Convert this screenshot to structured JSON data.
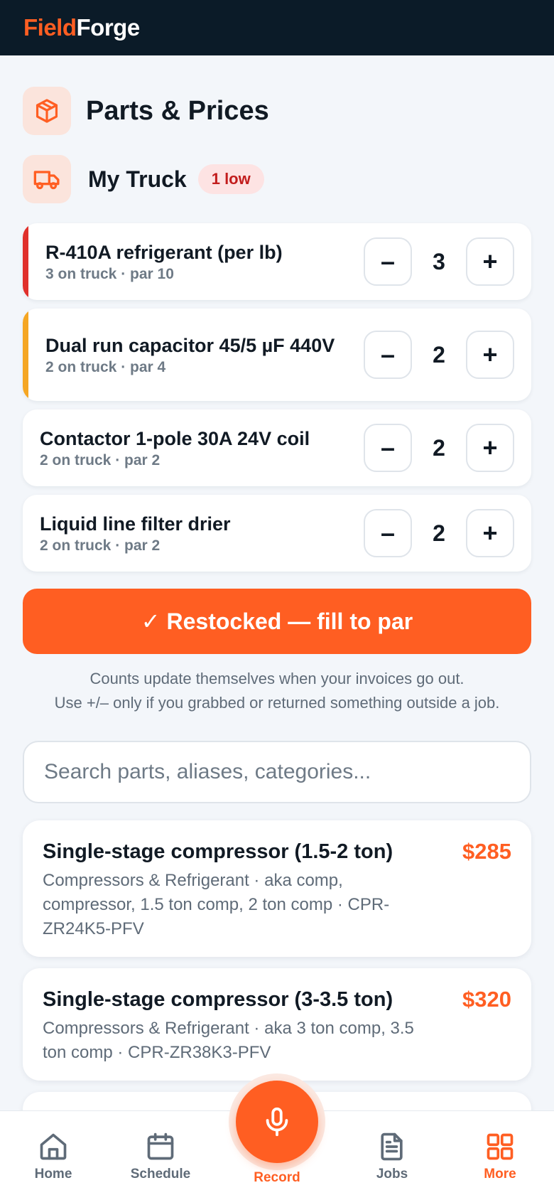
{
  "brand": {
    "part1": "Field",
    "part2": "Forge"
  },
  "page": {
    "title": "Parts & Prices"
  },
  "truck": {
    "title": "My Truck",
    "badge": "1 low",
    "items": [
      {
        "name": "R-410A refrigerant (per lb)",
        "sub": "3 on truck · par 10",
        "qty": "3",
        "flag_color": "#e0302b"
      },
      {
        "name": "Dual run capacitor 45/5 µF 440V",
        "sub": "2 on truck · par 4",
        "qty": "2",
        "flag_color": "#f5a623"
      },
      {
        "name": "Contactor 1-pole 30A 24V coil",
        "sub": "2 on truck · par 2",
        "qty": "2"
      },
      {
        "name": "Liquid line filter drier",
        "sub": "2 on truck · par 2",
        "qty": "2"
      }
    ],
    "minus": "–",
    "plus": "+",
    "restock_label": "✓ Restocked — fill to par",
    "hint_line1": "Counts update themselves when your invoices go out.",
    "hint_line2": "Use +/– only if you grabbed or returned something outside a job."
  },
  "search": {
    "placeholder": "Search parts, aliases, categories..."
  },
  "parts": [
    {
      "name": "Single-stage compressor (1.5-2 ton)",
      "price": "$285",
      "meta": "Compressors & Refrigerant · aka comp, compressor, 1.5 ton comp, 2 ton comp · CPR-ZR24K5-PFV"
    },
    {
      "name": "Single-stage compressor (3-3.5 ton)",
      "price": "$320",
      "meta": "Compressors & Refrigerant · aka 3 ton comp, 3.5 ton comp · CPR-ZR38K3-PFV"
    }
  ],
  "nav": {
    "home": "Home",
    "schedule": "Schedule",
    "record": "Record",
    "jobs": "Jobs",
    "more": "More"
  },
  "colors": {
    "accent": "#ff5e22",
    "header_bg": "#0b1b28",
    "low_red": "#e0302b",
    "warn_amber": "#f5a623"
  }
}
